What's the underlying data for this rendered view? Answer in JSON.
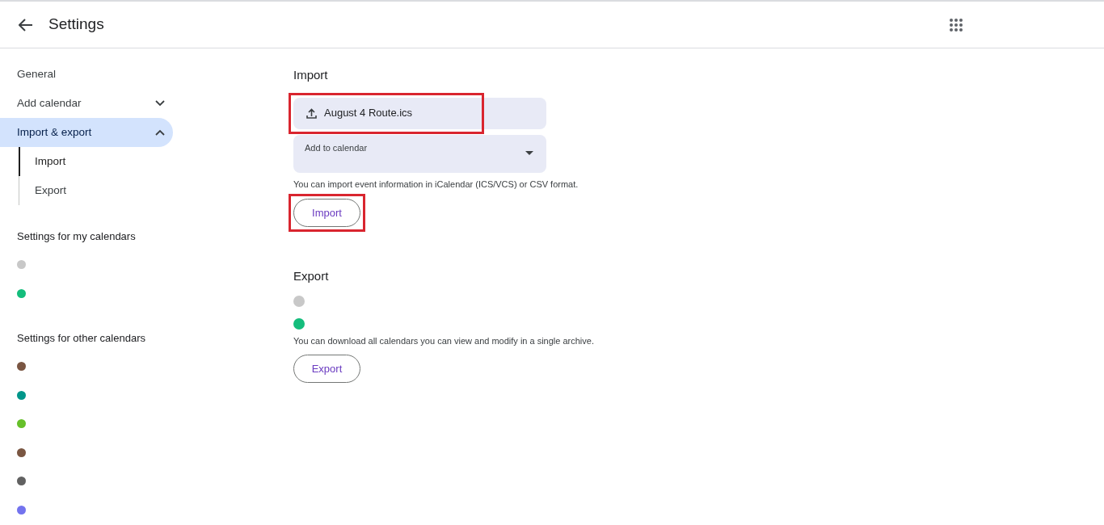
{
  "header": {
    "title": "Settings"
  },
  "sidebar": {
    "items": [
      {
        "label": "General",
        "selected": false
      },
      {
        "label": "Add calendar",
        "selected": false,
        "expanded": false
      },
      {
        "label": "Import & export",
        "selected": true,
        "expanded": true,
        "children": [
          {
            "label": "Import",
            "selected": true
          },
          {
            "label": "Export",
            "selected": false
          }
        ]
      }
    ],
    "sections": [
      {
        "title": "Settings for my calendars",
        "calendars": [
          {
            "color": "#c8c8c8"
          },
          {
            "color": "#14bd7c"
          }
        ]
      },
      {
        "title": "Settings for other calendars",
        "calendars": [
          {
            "color": "#7a5642"
          },
          {
            "color": "#00968a"
          },
          {
            "color": "#66c02a"
          },
          {
            "color": "#7a5642"
          },
          {
            "color": "#616161"
          },
          {
            "color": "#7373ee"
          }
        ]
      }
    ]
  },
  "import": {
    "title": "Import",
    "file_field": {
      "value": "August 4 Route.ics",
      "highlighted": true
    },
    "calendar_select": {
      "label": "Add to calendar"
    },
    "hint": "You can import event information in iCalendar (ICS/VCS) or CSV format.",
    "button": {
      "label": "Import",
      "highlighted": true
    }
  },
  "export": {
    "title": "Export",
    "calendars": [
      {
        "color": "#c8c8c8"
      },
      {
        "color": "#14bd7c"
      }
    ],
    "hint": "You can download all calendars you can view and modify in a single archive.",
    "button": {
      "label": "Export"
    }
  }
}
